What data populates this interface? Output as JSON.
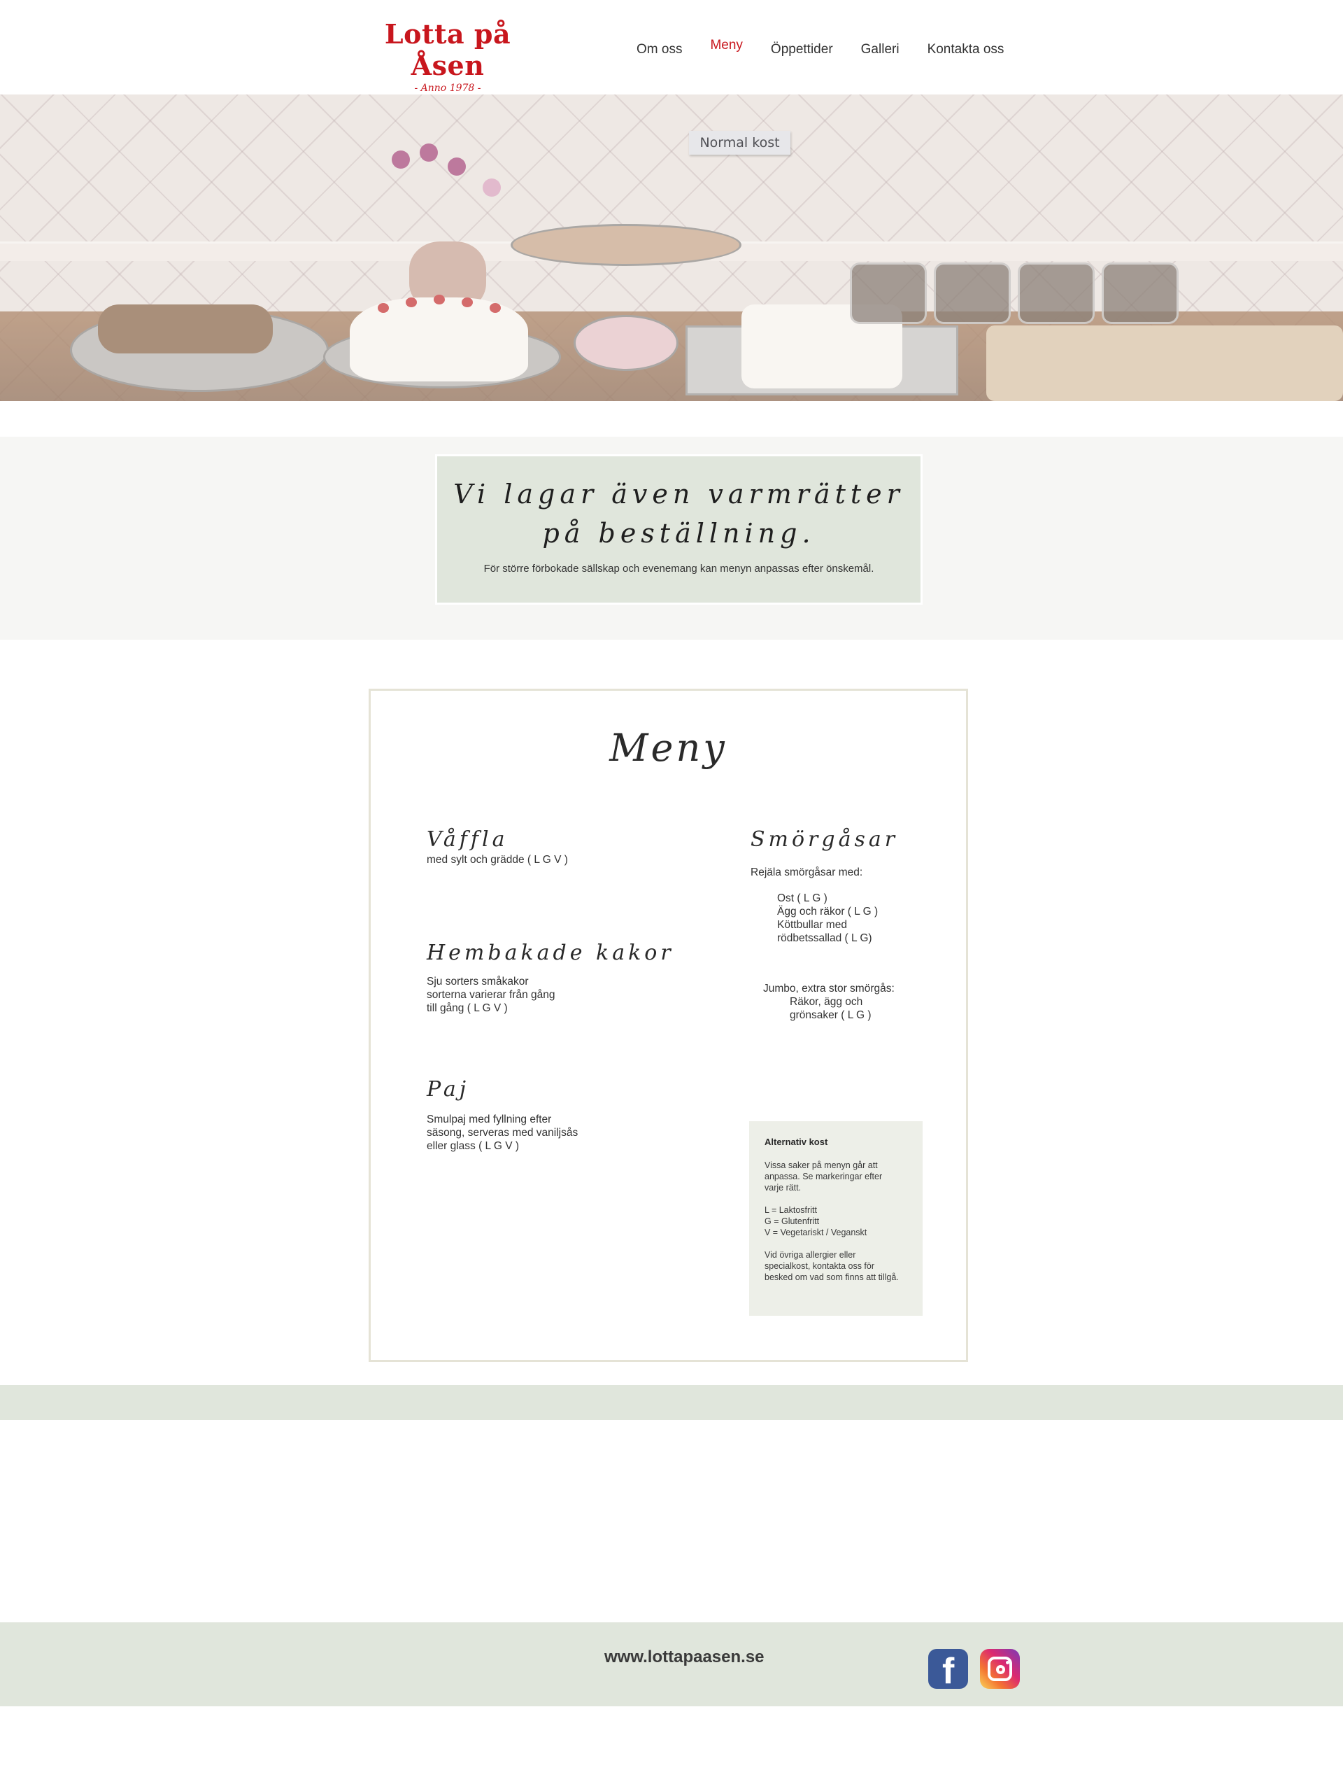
{
  "header": {
    "logo_title": "Lotta på Åsen",
    "logo_sub": "- Anno 1978 -",
    "nav": [
      {
        "label": "Om oss"
      },
      {
        "label": "Meny",
        "active": true
      },
      {
        "label": "Öppettider"
      },
      {
        "label": "Galleri"
      },
      {
        "label": "Kontakta oss"
      }
    ],
    "active_color": "#c8161d"
  },
  "hero": {
    "sign_text": "Normal kost"
  },
  "banner": {
    "title_line1": "Vi lagar även varmrätter",
    "title_line2": "på beställning.",
    "text": "För större förbokade sällskap och evenemang kan menyn anpassas efter önskemål."
  },
  "menu": {
    "title": "Meny",
    "left_sections": [
      {
        "title": "Våffla",
        "lines": [
          "med sylt och grädde ( L G V )"
        ]
      },
      {
        "title": "Hembakade kakor",
        "lines": [
          "Sju sorters småkakor",
          "sorterna varierar från gång",
          "till gång ( L G V )"
        ]
      },
      {
        "title": "Paj",
        "lines": [
          "Smulpaj med fyllning efter",
          "säsong, serveras med vaniljsås",
          "eller glass ( L G V )"
        ]
      }
    ],
    "sandwiches": {
      "title": "Smörgåsar",
      "intro": "Rejäla smörgåsar med:",
      "items": [
        "Ost ( L G )",
        "Ägg och räkor ( L G )",
        "Köttbullar med",
        "rödbetssallad ( L G)"
      ],
      "jumbo_title": "Jumbo, extra stor smörgås:",
      "jumbo_items": [
        "Räkor, ägg och",
        "grönsaker ( L G )"
      ]
    },
    "alt": {
      "title": "Alternativ kost",
      "p1": [
        "Vissa saker på menyn går att",
        "anpassa. Se markeringar efter",
        "varje rätt."
      ],
      "p2": [
        "L = Laktosfritt",
        "G = Glutenfritt",
        "V = Vegetariskt / Veganskt"
      ],
      "p3": [
        "Vid övriga allergier eller",
        "specialkost, kontakta oss för",
        "besked om vad som finns att tillgå."
      ]
    }
  },
  "footer": {
    "url": "www.lottapaasen.se",
    "icons": [
      "facebook-icon",
      "instagram-icon"
    ]
  },
  "colors": {
    "brand_red": "#c8161d",
    "sage": "#e0e6dc",
    "facebook_blue": "#3b5998"
  }
}
